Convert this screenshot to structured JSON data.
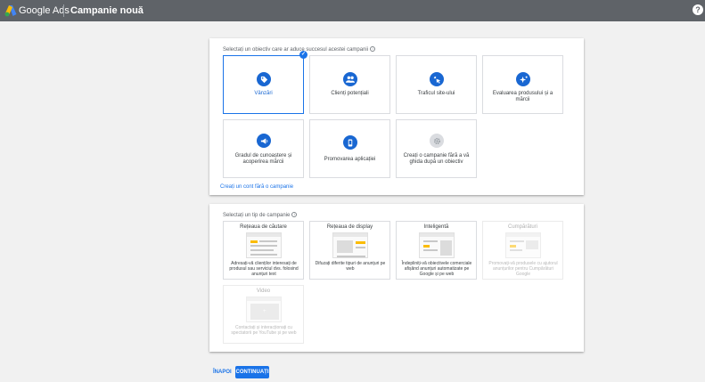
{
  "header": {
    "brand": "Google Ads",
    "page_title": "Campanie nouă",
    "help_glyph": "?"
  },
  "goals": {
    "prompt": "Selectați un obiectiv care ar aduce succesul acestei campanii",
    "items": [
      {
        "label": "Vânzări",
        "icon": "tag-icon",
        "selected": true
      },
      {
        "label": "Clienți potențiali",
        "icon": "people-icon",
        "selected": false
      },
      {
        "label": "Traficul site-ului",
        "icon": "cursor-click-icon",
        "selected": false
      },
      {
        "label": "Evaluarea produsului și a mărcii",
        "icon": "sparkle-icon",
        "selected": false
      },
      {
        "label": "Gradul de cunoaștere și acoperirea mărcii",
        "icon": "megaphone-icon",
        "selected": false
      },
      {
        "label": "Promovarea aplicației",
        "icon": "phone-icon",
        "selected": false
      },
      {
        "label": "Creați o campanie fără a vă ghida după un obiectiv",
        "icon": "gear-icon",
        "selected": false
      }
    ],
    "account_link": "Creați un cont fără o campanie"
  },
  "campaign_types": {
    "prompt": "Selectați un tip de campanie",
    "items": [
      {
        "title": "Rețeaua de căutare",
        "description": "Adresați-vă clienților interesați de produsul sau serviciul dvs. folosind anunțuri text",
        "enabled": true
      },
      {
        "title": "Rețeaua de display",
        "description": "Difuzați diferite tipuri de anunțuri pe web",
        "enabled": true
      },
      {
        "title": "Inteligentă",
        "description": "Îndepliniți-vă obiectivele comerciale afișând anunțuri automatizate pe Google și pe web",
        "enabled": true
      },
      {
        "title": "Cumpărături",
        "description": "Promovați-vă produsele cu ajutorul anunțurilor pentru Cumpărături Google",
        "enabled": false
      },
      {
        "title": "Video",
        "description": "Contactați și interacționați cu spectatorii pe YouTube și pe web",
        "enabled": false
      }
    ]
  },
  "footer": {
    "back_label": "ÎNAPOI",
    "continue_label": "CONTINUAȚI"
  },
  "colors": {
    "accent": "#1a73e8",
    "topbar": "#5f6368",
    "icon_circle": "#1967d2"
  }
}
